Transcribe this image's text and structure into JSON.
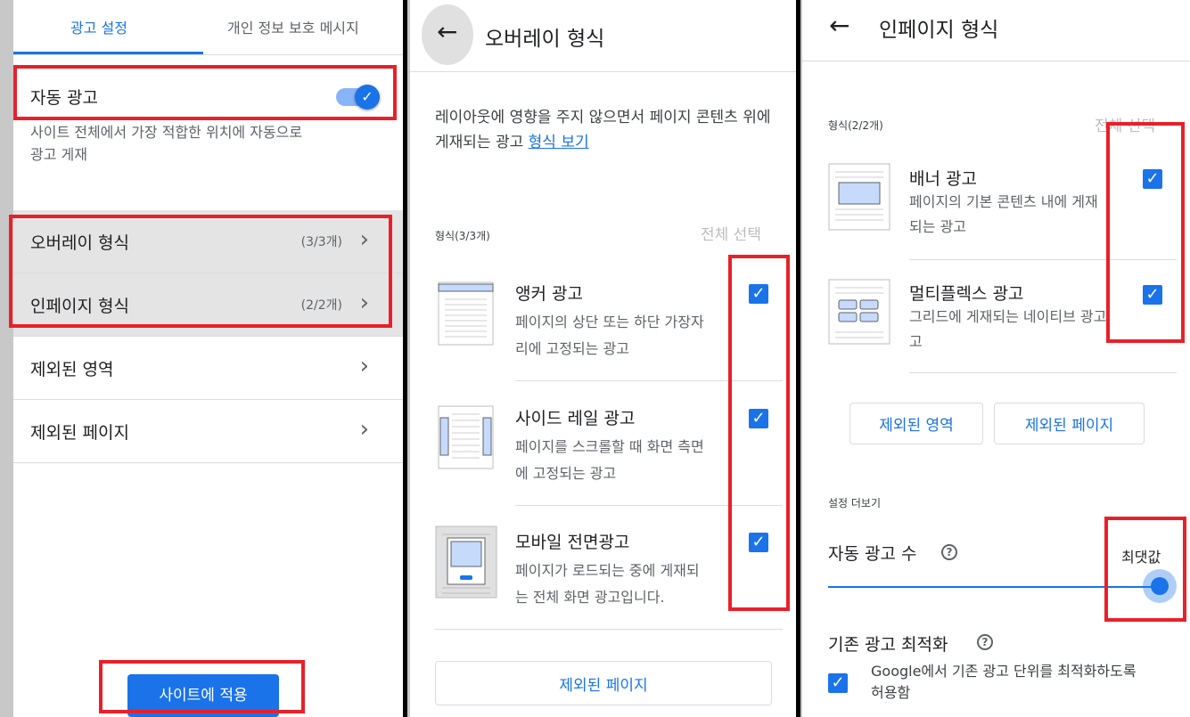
{
  "panel1": {
    "tabs": [
      {
        "label": "광고 설정",
        "active": true
      },
      {
        "label": "개인 정보 보호 메시지",
        "active": false
      }
    ],
    "auto_ads": {
      "label": "자동 광고",
      "enabled": true,
      "description": "사이트 전체에서 가장 적합한 위치에 자동으로 광고 게재"
    },
    "menu": [
      {
        "label": "오버레이 형식",
        "count": "(3/3개)"
      },
      {
        "label": "인페이지 형식",
        "count": "(2/2개)"
      },
      {
        "label": "제외된 영역",
        "count": ""
      },
      {
        "label": "제외된 페이지",
        "count": ""
      }
    ],
    "apply_button": "사이트에 적용"
  },
  "panel2": {
    "title": "오버레이 형식",
    "intro": "레이아웃에 영향을 주지 않으면서 페이지 콘텐츠 위에 게재되는 광고",
    "intro_link": "형식 보기",
    "formats_label": "형식(3/3개)",
    "select_all": "전체 선택",
    "formats": [
      {
        "title": "앵커 광고",
        "desc1": "페이지의 상단 또는 하단 가장자",
        "desc2": "리에 고정되는 광고",
        "checked": true
      },
      {
        "title": "사이드 레일 광고",
        "desc1": "페이지를 스크롤할 때 화면 측면",
        "desc2": "에 고정되는 광고",
        "checked": true
      },
      {
        "title": "모바일 전면광고",
        "desc1": "페이지가 로드되는 중에 게재되",
        "desc2": "는 전체 화면 광고입니다.",
        "checked": true
      }
    ],
    "excluded_pages_button": "제외된 페이지"
  },
  "panel3": {
    "title": "인페이지 형식",
    "formats_label": "형식(2/2개)",
    "select_all": "전체 선택",
    "formats": [
      {
        "title": "배너 광고",
        "desc1": "페이지의 기본 콘텐츠 내에 게재",
        "desc2": "되는 광고",
        "checked": true
      },
      {
        "title": "멀티플렉스 광고",
        "desc1": "그리드에 게재되는 네이티브 광고",
        "desc2": "고",
        "checked": true
      }
    ],
    "excluded_areas_button": "제외된 영역",
    "excluded_pages_button": "제외된 페이지",
    "more_settings_label": "설정 더보기",
    "ad_count": {
      "label": "자동 광고 수",
      "value_label": "최댓값",
      "level": 1.0
    },
    "optimize": {
      "label": "기존 광고 최적화",
      "checkbox_text1": "Google에서 기존 광고 단위를 최적화하도록",
      "checkbox_text2": "허용함",
      "checked": true
    }
  },
  "colors": {
    "accent": "#1a73e8",
    "highlight": "#e8202a"
  }
}
